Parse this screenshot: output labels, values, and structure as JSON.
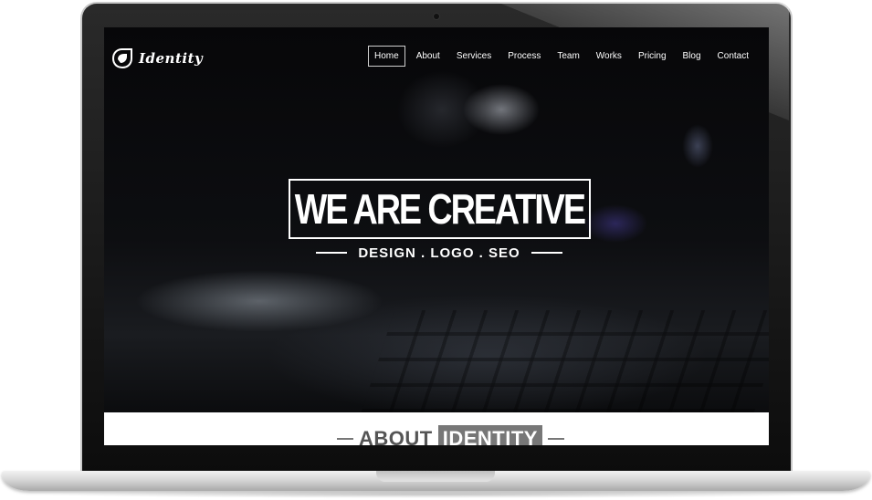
{
  "brand": {
    "logo_text": "Identity",
    "icon": "leaf-icon"
  },
  "nav": {
    "items": [
      {
        "label": "Home",
        "active": true
      },
      {
        "label": "About",
        "active": false
      },
      {
        "label": "Services",
        "active": false
      },
      {
        "label": "Process",
        "active": false
      },
      {
        "label": "Team",
        "active": false
      },
      {
        "label": "Works",
        "active": false
      },
      {
        "label": "Pricing",
        "active": false
      },
      {
        "label": "Blog",
        "active": false
      },
      {
        "label": "Contact",
        "active": false
      }
    ]
  },
  "hero": {
    "title": "WE ARE CREATIVE",
    "subtitle": "DESIGN . LOGO . SEO"
  },
  "about": {
    "heading_word": "ABOUT",
    "heading_highlight": "IDENTITY"
  },
  "colors": {
    "hero_bg": "#060608",
    "text": "#ffffff",
    "about_accent": "#777777"
  }
}
